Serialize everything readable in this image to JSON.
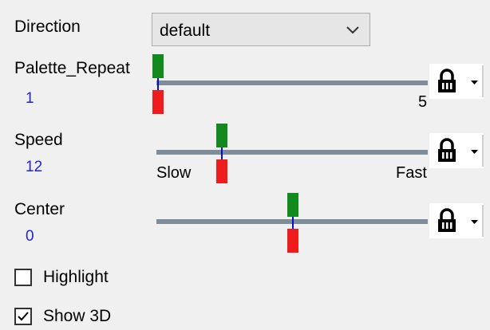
{
  "direction": {
    "label": "Direction",
    "selected": "default"
  },
  "palette_repeat": {
    "label": "Palette_Repeat",
    "value": "1",
    "max_label": "5"
  },
  "speed": {
    "label": "Speed",
    "value": "12",
    "min_label": "Slow",
    "max_label": "Fast"
  },
  "center": {
    "label": "Center",
    "value": "0"
  },
  "highlight": {
    "label": "Highlight",
    "checked": false
  },
  "show3d": {
    "label": "Show 3D",
    "checked": true
  },
  "icons": {
    "lock": "lock-icon",
    "dropdown": "chevron-down-icon"
  },
  "colors": {
    "track": "#7f8c99",
    "handle_top": "#138a1e",
    "handle_bottom": "#ee1c1c",
    "needle": "#0b0bd6",
    "value_text": "#2222dd"
  }
}
